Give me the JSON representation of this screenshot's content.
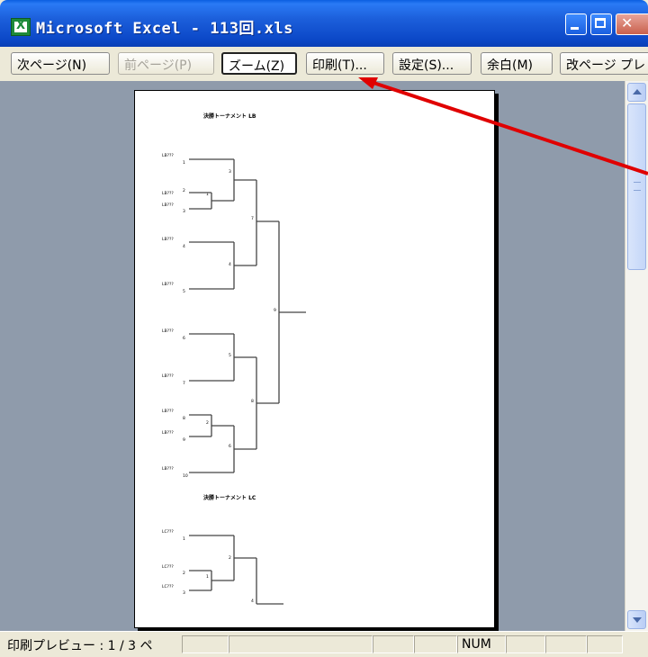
{
  "window": {
    "title": "Microsoft Excel - 113回.xls",
    "app_icon": "excel-icon"
  },
  "toolbar": {
    "next_page": "次ページ(N)",
    "prev_page": "前ページ(P)",
    "zoom": "ズーム(Z)",
    "print": "印刷(T)...",
    "setup": "設定(S)...",
    "margins": "余白(M)",
    "page_break": "改ページ プレ"
  },
  "page": {
    "section1_title": "決勝トーナメント LB",
    "section2_title": "決勝トーナメント LC",
    "section1_players": [
      {
        "name": "LB???",
        "num": "1"
      },
      {
        "name": "LB???",
        "num": "2"
      },
      {
        "name": "LB???",
        "num": "3"
      },
      {
        "name": "LB???",
        "num": "4"
      },
      {
        "name": "LB???",
        "num": "5"
      },
      {
        "name": "LB???",
        "num": "6"
      },
      {
        "name": "LB???",
        "num": "7"
      },
      {
        "name": "LB???",
        "num": "8"
      },
      {
        "name": "LB???",
        "num": "9"
      },
      {
        "name": "LB???",
        "num": "10"
      }
    ],
    "section2_players": [
      {
        "name": "LC???",
        "num": "1"
      },
      {
        "name": "LC???",
        "num": "2"
      },
      {
        "name": "LC???",
        "num": "3"
      }
    ],
    "match_numbers": [
      "3",
      "1",
      "7",
      "4",
      "9",
      "5",
      "8",
      "2",
      "6",
      "2",
      "1",
      "4"
    ]
  },
  "status": {
    "text": "印刷プレビュー : 1 / 3 ペ",
    "num_indicator": "NUM"
  },
  "colors": {
    "titlebar": "#0b47c7",
    "preview_bg": "#8f9bab",
    "annotation_arrow": "#e00000"
  }
}
